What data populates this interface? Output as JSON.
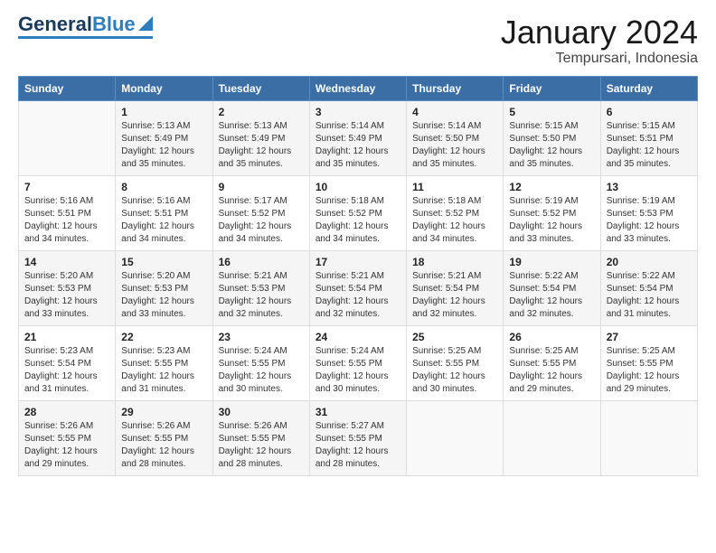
{
  "header": {
    "logo_general": "General",
    "logo_blue": "Blue",
    "title": "January 2024",
    "subtitle": "Tempursari, Indonesia"
  },
  "weekdays": [
    "Sunday",
    "Monday",
    "Tuesday",
    "Wednesday",
    "Thursday",
    "Friday",
    "Saturday"
  ],
  "rows": [
    [
      {
        "day": "",
        "info": ""
      },
      {
        "day": "1",
        "info": "Sunrise: 5:13 AM\nSunset: 5:49 PM\nDaylight: 12 hours\nand 35 minutes."
      },
      {
        "day": "2",
        "info": "Sunrise: 5:13 AM\nSunset: 5:49 PM\nDaylight: 12 hours\nand 35 minutes."
      },
      {
        "day": "3",
        "info": "Sunrise: 5:14 AM\nSunset: 5:49 PM\nDaylight: 12 hours\nand 35 minutes."
      },
      {
        "day": "4",
        "info": "Sunrise: 5:14 AM\nSunset: 5:50 PM\nDaylight: 12 hours\nand 35 minutes."
      },
      {
        "day": "5",
        "info": "Sunrise: 5:15 AM\nSunset: 5:50 PM\nDaylight: 12 hours\nand 35 minutes."
      },
      {
        "day": "6",
        "info": "Sunrise: 5:15 AM\nSunset: 5:51 PM\nDaylight: 12 hours\nand 35 minutes."
      }
    ],
    [
      {
        "day": "7",
        "info": "Sunrise: 5:16 AM\nSunset: 5:51 PM\nDaylight: 12 hours\nand 34 minutes."
      },
      {
        "day": "8",
        "info": "Sunrise: 5:16 AM\nSunset: 5:51 PM\nDaylight: 12 hours\nand 34 minutes."
      },
      {
        "day": "9",
        "info": "Sunrise: 5:17 AM\nSunset: 5:52 PM\nDaylight: 12 hours\nand 34 minutes."
      },
      {
        "day": "10",
        "info": "Sunrise: 5:18 AM\nSunset: 5:52 PM\nDaylight: 12 hours\nand 34 minutes."
      },
      {
        "day": "11",
        "info": "Sunrise: 5:18 AM\nSunset: 5:52 PM\nDaylight: 12 hours\nand 34 minutes."
      },
      {
        "day": "12",
        "info": "Sunrise: 5:19 AM\nSunset: 5:52 PM\nDaylight: 12 hours\nand 33 minutes."
      },
      {
        "day": "13",
        "info": "Sunrise: 5:19 AM\nSunset: 5:53 PM\nDaylight: 12 hours\nand 33 minutes."
      }
    ],
    [
      {
        "day": "14",
        "info": "Sunrise: 5:20 AM\nSunset: 5:53 PM\nDaylight: 12 hours\nand 33 minutes."
      },
      {
        "day": "15",
        "info": "Sunrise: 5:20 AM\nSunset: 5:53 PM\nDaylight: 12 hours\nand 33 minutes."
      },
      {
        "day": "16",
        "info": "Sunrise: 5:21 AM\nSunset: 5:53 PM\nDaylight: 12 hours\nand 32 minutes."
      },
      {
        "day": "17",
        "info": "Sunrise: 5:21 AM\nSunset: 5:54 PM\nDaylight: 12 hours\nand 32 minutes."
      },
      {
        "day": "18",
        "info": "Sunrise: 5:21 AM\nSunset: 5:54 PM\nDaylight: 12 hours\nand 32 minutes."
      },
      {
        "day": "19",
        "info": "Sunrise: 5:22 AM\nSunset: 5:54 PM\nDaylight: 12 hours\nand 32 minutes."
      },
      {
        "day": "20",
        "info": "Sunrise: 5:22 AM\nSunset: 5:54 PM\nDaylight: 12 hours\nand 31 minutes."
      }
    ],
    [
      {
        "day": "21",
        "info": "Sunrise: 5:23 AM\nSunset: 5:54 PM\nDaylight: 12 hours\nand 31 minutes."
      },
      {
        "day": "22",
        "info": "Sunrise: 5:23 AM\nSunset: 5:55 PM\nDaylight: 12 hours\nand 31 minutes."
      },
      {
        "day": "23",
        "info": "Sunrise: 5:24 AM\nSunset: 5:55 PM\nDaylight: 12 hours\nand 30 minutes."
      },
      {
        "day": "24",
        "info": "Sunrise: 5:24 AM\nSunset: 5:55 PM\nDaylight: 12 hours\nand 30 minutes."
      },
      {
        "day": "25",
        "info": "Sunrise: 5:25 AM\nSunset: 5:55 PM\nDaylight: 12 hours\nand 30 minutes."
      },
      {
        "day": "26",
        "info": "Sunrise: 5:25 AM\nSunset: 5:55 PM\nDaylight: 12 hours\nand 29 minutes."
      },
      {
        "day": "27",
        "info": "Sunrise: 5:25 AM\nSunset: 5:55 PM\nDaylight: 12 hours\nand 29 minutes."
      }
    ],
    [
      {
        "day": "28",
        "info": "Sunrise: 5:26 AM\nSunset: 5:55 PM\nDaylight: 12 hours\nand 29 minutes."
      },
      {
        "day": "29",
        "info": "Sunrise: 5:26 AM\nSunset: 5:55 PM\nDaylight: 12 hours\nand 28 minutes."
      },
      {
        "day": "30",
        "info": "Sunrise: 5:26 AM\nSunset: 5:55 PM\nDaylight: 12 hours\nand 28 minutes."
      },
      {
        "day": "31",
        "info": "Sunrise: 5:27 AM\nSunset: 5:55 PM\nDaylight: 12 hours\nand 28 minutes."
      },
      {
        "day": "",
        "info": ""
      },
      {
        "day": "",
        "info": ""
      },
      {
        "day": "",
        "info": ""
      }
    ]
  ]
}
